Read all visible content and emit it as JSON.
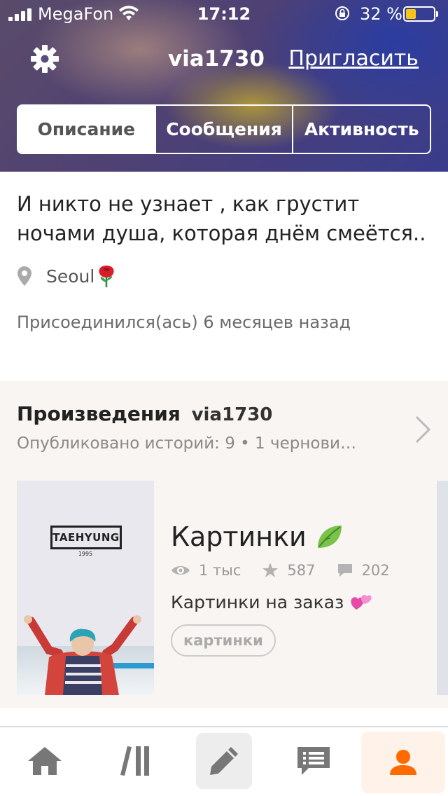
{
  "status_bar": {
    "carrier": "MegaFon",
    "time": "17:12",
    "battery_percent": "32 %",
    "battery_level": 0.32
  },
  "header": {
    "username": "via1730",
    "invite_label": "Пригласить",
    "settings_icon": "gear-icon"
  },
  "tabs": [
    {
      "label": "Описание",
      "active": true
    },
    {
      "label": "Сообщения",
      "active": false
    },
    {
      "label": "Активность",
      "active": false
    }
  ],
  "profile": {
    "bio": "И никто не узнает , как грустит ночами душа, которая днём смеётся..",
    "location": "Seoul",
    "joined": "Присоединился(ась) 6 месяцев назад"
  },
  "works": {
    "title": "Произведения",
    "username": "via1730",
    "subtitle": "Опубликовано историй: 9 • 1 чернови…",
    "story": {
      "cover_label": "TAEHYUNG",
      "cover_year": "1995",
      "title": "Картинки",
      "views": "1 тыс",
      "votes": "587",
      "comments": "202",
      "description": "Картинки на заказ",
      "tag": "картинки"
    }
  },
  "bottom_nav": [
    {
      "name": "home-icon"
    },
    {
      "name": "library-icon"
    },
    {
      "name": "pencil-icon"
    },
    {
      "name": "messages-icon"
    },
    {
      "name": "profile-icon",
      "active": true
    }
  ],
  "colors": {
    "accent": "#ff6a00",
    "battery": "#f5c518"
  }
}
